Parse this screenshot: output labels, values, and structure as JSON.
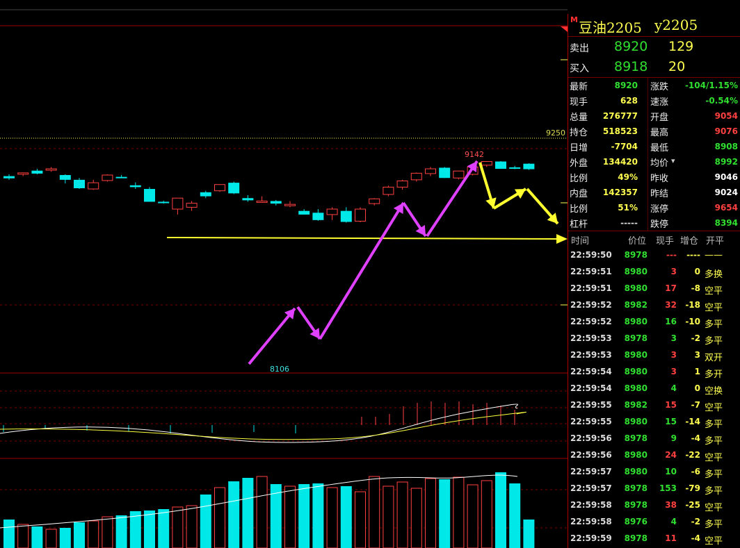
{
  "quote": {
    "market_badge": "M",
    "name": "豆油2205",
    "code": "y2205",
    "ask_label": "卖出",
    "ask_price": "8920",
    "ask_volume": "129",
    "bid_label": "买入",
    "bid_price": "8918",
    "bid_volume": "20"
  },
  "stats_left": [
    {
      "label": "最新",
      "value": "8920",
      "color": "#30e030"
    },
    {
      "label": "现手",
      "value": "628",
      "color": "#ffff50"
    },
    {
      "label": "总量",
      "value": "276777",
      "color": "#ffff50"
    },
    {
      "label": "持仓",
      "value": "518523",
      "color": "#ffff50"
    },
    {
      "label": "日增",
      "value": "-7704",
      "color": "#ffff50"
    },
    {
      "label": "外盘",
      "value": "134420",
      "color": "#ffff50"
    },
    {
      "label": "比例",
      "value": "49%",
      "color": "#ffff50"
    },
    {
      "label": "内盘",
      "value": "142357",
      "color": "#ffff50"
    },
    {
      "label": "比例",
      "value": "51%",
      "color": "#ffff50"
    },
    {
      "label": "杠杆",
      "value": "-----",
      "color": "#dddddd"
    }
  ],
  "stats_right": [
    {
      "label": "涨跌",
      "value": "-104/1.15%",
      "color": "#30e030"
    },
    {
      "label": "速涨",
      "value": "-0.54%",
      "color": "#30e030"
    },
    {
      "label": "开盘",
      "value": "9054",
      "color": "#ff4040"
    },
    {
      "label": "最高",
      "value": "9076",
      "color": "#ff4040"
    },
    {
      "label": "最低",
      "value": "8908",
      "color": "#30e030"
    },
    {
      "label": "均价",
      "value": "8992",
      "color": "#30e030"
    },
    {
      "label": "昨收",
      "value": "9046",
      "color": "#ffffff"
    },
    {
      "label": "昨结",
      "value": "9024",
      "color": "#ffffff"
    },
    {
      "label": "涨停",
      "value": "9654",
      "color": "#ff4040"
    },
    {
      "label": "跌停",
      "value": "8394",
      "color": "#30e030"
    }
  ],
  "ticks_header": {
    "time": "时间",
    "price": "价位",
    "volume": "现手",
    "oi_change": "增仓",
    "open_close": "开平"
  },
  "ticks": [
    {
      "time": "22:59:50",
      "price": "8978",
      "volume": "---",
      "oi": "----",
      "type": "——",
      "vcolor": "#ff4040",
      "ocolor": "#ffff50"
    },
    {
      "time": "22:59:51",
      "price": "8980",
      "volume": "3",
      "oi": "0",
      "type": "多换",
      "vcolor": "#ff4040",
      "ocolor": "#ffff50"
    },
    {
      "time": "22:59:51",
      "price": "8980",
      "volume": "17",
      "oi": "-8",
      "type": "空平",
      "vcolor": "#ff4040",
      "ocolor": "#ffff50"
    },
    {
      "time": "22:59:52",
      "price": "8982",
      "volume": "32",
      "oi": "-18",
      "type": "空平",
      "vcolor": "#ff4040",
      "ocolor": "#ffff50"
    },
    {
      "time": "22:59:52",
      "price": "8980",
      "volume": "16",
      "oi": "-10",
      "type": "多平",
      "vcolor": "#30e030",
      "ocolor": "#ffff50"
    },
    {
      "time": "22:59:53",
      "price": "8978",
      "volume": "3",
      "oi": "-2",
      "type": "多平",
      "vcolor": "#30e030",
      "ocolor": "#ffff50"
    },
    {
      "time": "22:59:53",
      "price": "8980",
      "volume": "3",
      "oi": "3",
      "type": "双开",
      "vcolor": "#ff4040",
      "ocolor": "#ffff50"
    },
    {
      "time": "22:59:54",
      "price": "8980",
      "volume": "3",
      "oi": "1",
      "type": "多开",
      "vcolor": "#ff4040",
      "ocolor": "#ffff50"
    },
    {
      "time": "22:59:54",
      "price": "8980",
      "volume": "4",
      "oi": "0",
      "type": "空换",
      "vcolor": "#30e030",
      "ocolor": "#ffff50"
    },
    {
      "time": "22:59:55",
      "price": "8982",
      "volume": "15",
      "oi": "-7",
      "type": "空平",
      "vcolor": "#ff4040",
      "ocolor": "#ffff50"
    },
    {
      "time": "22:59:55",
      "price": "8980",
      "volume": "15",
      "oi": "-14",
      "type": "多平",
      "vcolor": "#30e030",
      "ocolor": "#ffff50"
    },
    {
      "time": "22:59:56",
      "price": "8978",
      "volume": "9",
      "oi": "-4",
      "type": "多平",
      "vcolor": "#30e030",
      "ocolor": "#ffff50"
    },
    {
      "time": "22:59:56",
      "price": "8980",
      "volume": "24",
      "oi": "-22",
      "type": "空平",
      "vcolor": "#ff4040",
      "ocolor": "#ffff50"
    },
    {
      "time": "22:59:57",
      "price": "8980",
      "volume": "10",
      "oi": "-6",
      "type": "多平",
      "vcolor": "#30e030",
      "ocolor": "#ffff50"
    },
    {
      "time": "22:59:57",
      "price": "8978",
      "volume": "153",
      "oi": "-79",
      "type": "多平",
      "vcolor": "#30e030",
      "ocolor": "#ffff50"
    },
    {
      "time": "22:59:58",
      "price": "8978",
      "volume": "38",
      "oi": "-25",
      "type": "空平",
      "vcolor": "#ff4040",
      "ocolor": "#ffff50"
    },
    {
      "time": "22:59:58",
      "price": "8976",
      "volume": "4",
      "oi": "-2",
      "type": "多平",
      "vcolor": "#30e030",
      "ocolor": "#ffff50"
    },
    {
      "time": "22:59:59",
      "price": "8978",
      "volume": "11",
      "oi": "-4",
      "type": "空平",
      "vcolor": "#ff4040",
      "ocolor": "#ffff50"
    }
  ],
  "chart": {
    "price_level_label": "9250",
    "high_label": "9142",
    "low_label": "8106",
    "candles": [
      [
        9060,
        9070,
        9040,
        9048
      ],
      [
        9072,
        9080,
        9060,
        9078
      ],
      [
        9090,
        9100,
        9070,
        9074
      ],
      [
        9096,
        9110,
        9084,
        9100
      ],
      [
        9066,
        9070,
        9020,
        9040
      ],
      [
        9040,
        9050,
        8990,
        8994
      ],
      [
        8990,
        9040,
        8985,
        9024
      ],
      [
        9036,
        9070,
        9030,
        9066
      ],
      [
        9056,
        9066,
        9050,
        9054
      ],
      [
        9010,
        9026,
        8990,
        9000
      ],
      [
        8990,
        9000,
        8920,
        8920
      ],
      [
        8920,
        8926,
        8910,
        8914
      ],
      [
        8880,
        8940,
        8850,
        8940
      ],
      [
        8890,
        8924,
        8870,
        8912
      ],
      [
        8972,
        8980,
        8940,
        8950
      ],
      [
        8980,
        9016,
        8974,
        9014
      ],
      [
        9024,
        9030,
        8962,
        8966
      ],
      [
        8940,
        8956,
        8920,
        8928
      ],
      [
        8924,
        8950,
        8916,
        8924
      ],
      [
        8924,
        8930,
        8900,
        8910
      ],
      [
        8900,
        8924,
        8890,
        8906
      ],
      [
        8870,
        8880,
        8850,
        8850
      ],
      [
        8860,
        8880,
        8816,
        8820
      ],
      [
        8850,
        8890,
        8820,
        8880
      ],
      [
        8870,
        8890,
        8806,
        8810
      ],
      [
        8814,
        8890,
        8808,
        8880
      ],
      [
        8910,
        8940,
        8900,
        8936
      ],
      [
        8960,
        9008,
        8950,
        9000
      ],
      [
        9000,
        9040,
        8986,
        9034
      ],
      [
        9040,
        9080,
        9030,
        9076
      ],
      [
        9074,
        9110,
        9060,
        9100
      ],
      [
        9106,
        9110,
        9050,
        9050
      ],
      [
        9050,
        9090,
        9042,
        9088
      ],
      [
        9070,
        9120,
        9064,
        9110
      ],
      [
        9120,
        9142,
        9110,
        9140
      ],
      [
        9140,
        9142,
        9100,
        9100
      ],
      [
        9108,
        9116,
        9098,
        9104
      ],
      [
        9128,
        9130,
        9094,
        9098
      ]
    ]
  }
}
